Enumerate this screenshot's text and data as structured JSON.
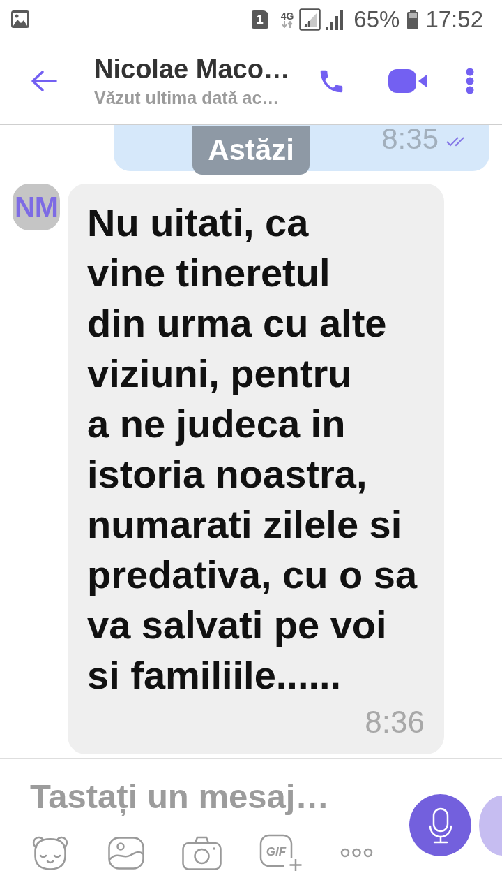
{
  "status_bar": {
    "sim_slot": "1",
    "network": "4G",
    "battery": "65%",
    "time": "17:52"
  },
  "header": {
    "contact_name": "Nicolae Maco…",
    "last_seen": "Văzut ultima dată ac…"
  },
  "chat": {
    "date_separator": "Astăzi",
    "messages": [
      {
        "kind": "outgoing",
        "time": "8:35",
        "read": true
      },
      {
        "kind": "incoming",
        "avatar_initials": "NM",
        "text": "Nu uitati, ca\nvine tineretul\ndin urma cu alte\nviziuni, pentru\na ne judeca in\nistoria noastra,\nnumarati zilele si\npredativa, cu o sa\nva salvati pe voi\nsi familiile......",
        "time": "8:36"
      }
    ]
  },
  "composer": {
    "placeholder": "Tastați un mesaj…",
    "tools": [
      {
        "kind": "sticker"
      },
      {
        "kind": "gallery"
      },
      {
        "kind": "camera"
      },
      {
        "kind": "gif",
        "label": "GIF"
      },
      {
        "kind": "more"
      }
    ]
  }
}
